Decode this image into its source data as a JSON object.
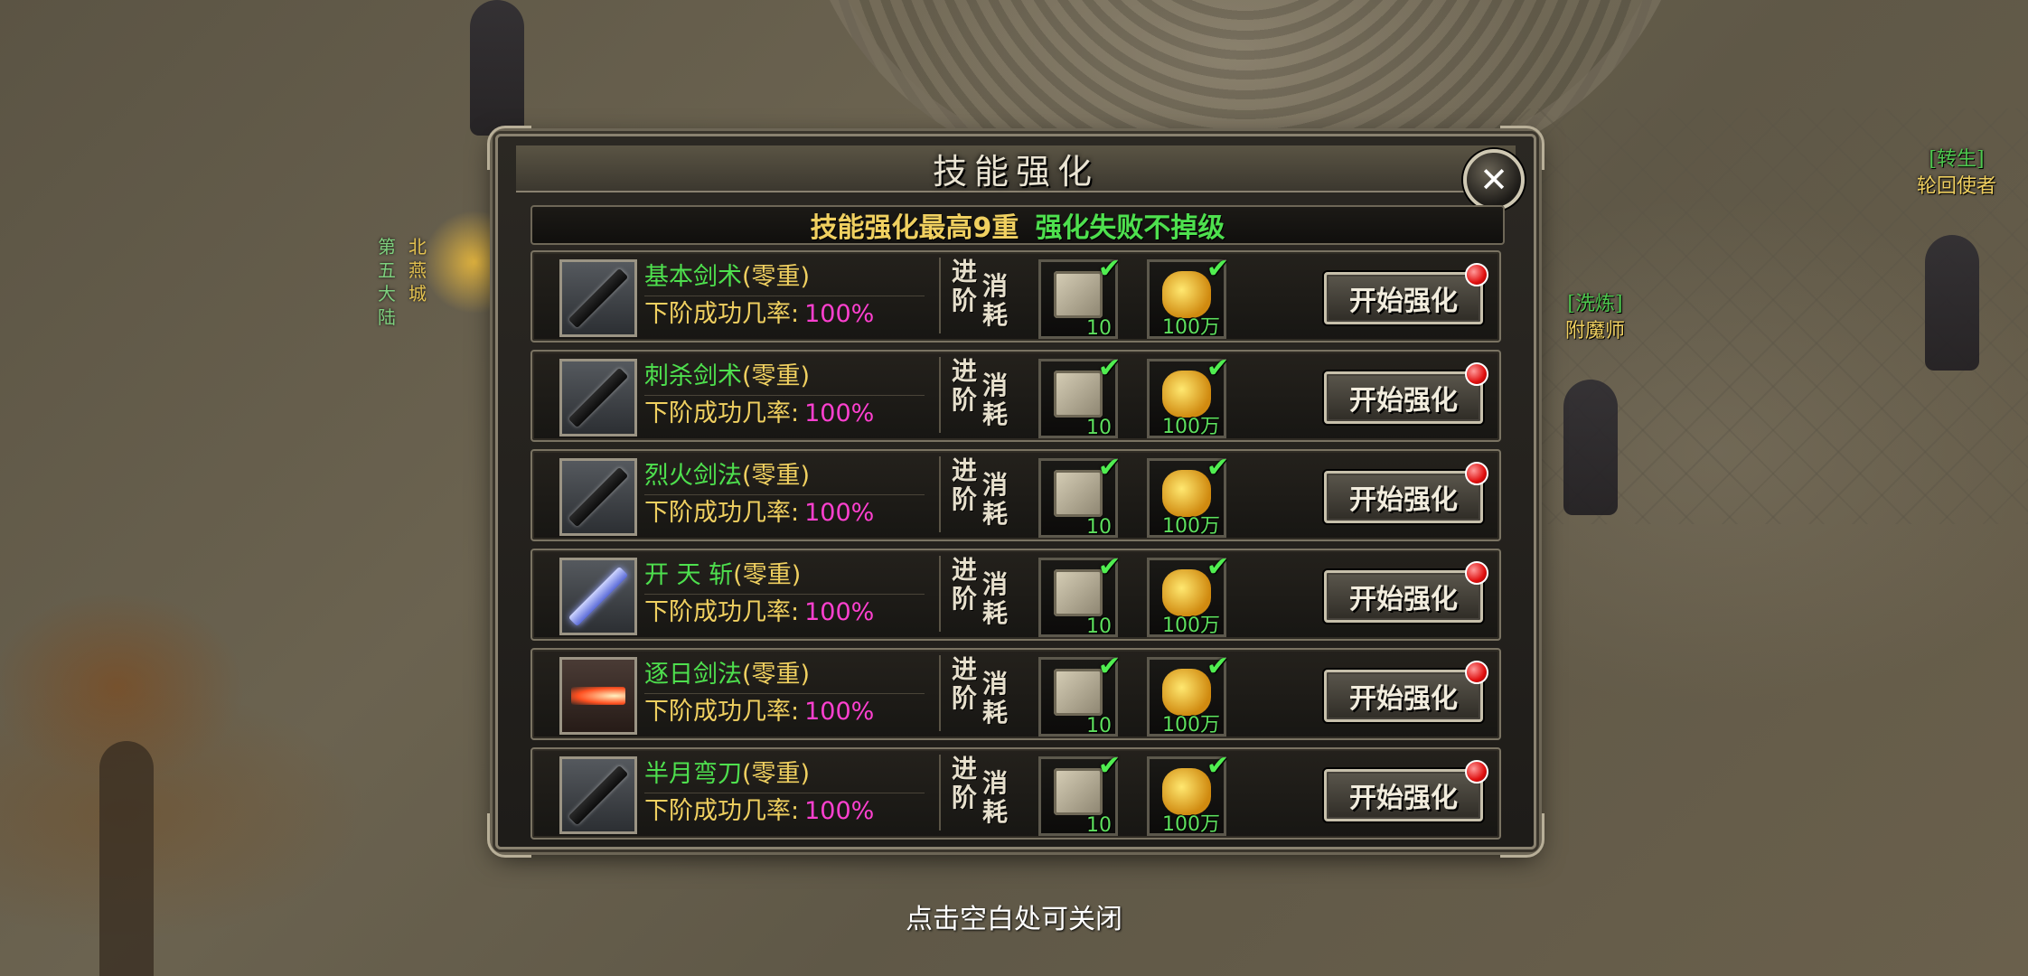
{
  "scene": {
    "sign_left": "第五大陆",
    "sign_right": "北燕城",
    "npc_top_right": {
      "tag": "[转生]",
      "name": "轮回使者"
    },
    "npc_mid_right": {
      "tag": "[洗炼]",
      "name": "附魔师"
    }
  },
  "dialog": {
    "title": "技能强化",
    "banner_part1": "技能强化最高9重",
    "banner_part2": "强化失败不掉级",
    "cost_label_col1": "进阶",
    "cost_label_col2": "消耗",
    "rate_label": "下阶成功几率:",
    "start_button_label": "开始强化",
    "close_icon": "close-icon",
    "scroll_icon": "scroll-icon",
    "gold_icon": "gold-coins-icon",
    "check_icon": "check-icon",
    "skills": [
      {
        "name": "基本剑术",
        "level": "(零重)",
        "rate": "100%",
        "scroll_qty": "10",
        "gold_qty": "100万",
        "icon": "sword-icon"
      },
      {
        "name": "刺杀剑术",
        "level": "(零重)",
        "rate": "100%",
        "scroll_qty": "10",
        "gold_qty": "100万",
        "icon": "thrust-sword-icon"
      },
      {
        "name": "烈火剑法",
        "level": "(零重)",
        "rate": "100%",
        "scroll_qty": "10",
        "gold_qty": "100万",
        "icon": "flame-sword-icon"
      },
      {
        "name": "开 天 斩",
        "level": "(零重)",
        "rate": "100%",
        "scroll_qty": "10",
        "gold_qty": "100万",
        "icon": "sky-slash-icon"
      },
      {
        "name": "逐日剑法",
        "level": "(零重)",
        "rate": "100%",
        "scroll_qty": "10",
        "gold_qty": "100万",
        "icon": "fire-blast-icon"
      },
      {
        "name": "半月弯刀",
        "level": "(零重)",
        "rate": "100%",
        "scroll_qty": "10",
        "gold_qty": "100万",
        "icon": "half-moon-blade-icon"
      }
    ]
  },
  "close_hint": "点击空白处可关闭",
  "colors": {
    "skill_name": "#4ee04e",
    "level_text": "#f0d060",
    "rate_value": "#ff40d0",
    "banner_part1": "#f0d060",
    "banner_part2": "#4ee04e",
    "notify_dot": "#e01010"
  }
}
